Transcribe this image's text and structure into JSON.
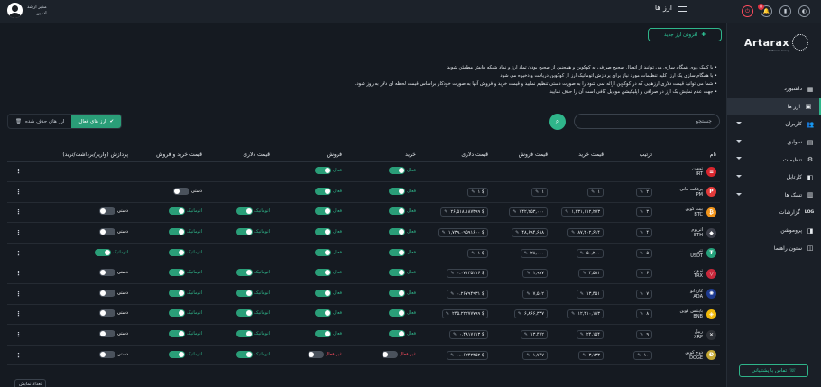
{
  "header": {
    "title": "ارز ها",
    "user_line1": "مدیر ارشد",
    "user_line2": "ادمین",
    "notification_count": "0"
  },
  "sidebar": {
    "logo_name": "Artarax",
    "logo_sub": "Software Group",
    "items": [
      {
        "label": "داشبورد",
        "icon": "▦",
        "chevron": false,
        "active": false
      },
      {
        "label": "ارز ها",
        "icon": "▣",
        "chevron": false,
        "active": true
      },
      {
        "label": "کاربران",
        "icon": "👥",
        "chevron": true,
        "active": false
      },
      {
        "label": "سوابق",
        "icon": "▤",
        "chevron": true,
        "active": false
      },
      {
        "label": "تنظیمات",
        "icon": "⚙",
        "chevron": true,
        "active": false
      },
      {
        "label": "کارتابل",
        "icon": "◧",
        "chevron": true,
        "active": false
      },
      {
        "label": "تسک ها",
        "icon": "▥",
        "chevron": true,
        "active": false
      },
      {
        "label": "گزارشات",
        "icon": "LOG",
        "chevron": false,
        "active": false
      },
      {
        "label": "پروموشن",
        "icon": "◨",
        "chevron": false,
        "active": false
      },
      {
        "label": "ستون راهنما",
        "icon": "◫",
        "chevron": false,
        "active": false
      }
    ],
    "support_label": "تماس با پشتیبانی"
  },
  "toolbar": {
    "add_label": "افزودن ارز جدید",
    "search_placeholder": "جستجو",
    "tab_active_label": "ارز های فعال",
    "tab_deleted_label": "ارز های حذف شده"
  },
  "notes": [
    "• با کلیک روی همگام سازی می توانید از اتصال صحیح صرافی به کوکوین و همچنین از صحیح بودن تماد ارز و نماد شبکه هایش مطمئن شوید",
    "• با همگام سازی یک ارز، کلیه تنظیمات مورد نیاز برای پردازش اتوماتیک ارز از کوکوین دریافت و ذخیره می شود",
    "• شما می توانید قیمت دلاری ارزهایی که در کوکوین ارائه نمی شود را به صورت دستی تنظیم نمایید و قیمت خرید و فروش آنها به صورت خودکار براساس قیمت لحظه ای دلار به روز شود.",
    "• جهت عدم نمایش یک ارز در صرافی و اپلیکیشن موبایل کافی است آن را حذف نمایید"
  ],
  "table": {
    "headers": {
      "name": "نام",
      "order": "ترتیب",
      "buy_price": "قیمت خرید",
      "sell_price": "قیمت فروش",
      "usd_price": "قیمت دلاری",
      "buy": "خرید",
      "sell": "فروش",
      "usd_mode": "قیمت دلاری",
      "buysell_mode": "قیمت خرید و فروش",
      "process": "پردازش (واریز/برداشت/ترید)"
    },
    "rows": [
      {
        "name": "تومان",
        "symbol": "IRT",
        "coin_color": "#d9262e",
        "coin_glyph": "≡",
        "order": "",
        "buy_price": "",
        "sell_price": "",
        "usd_price": "",
        "buy": {
          "on": true,
          "label": "فعال"
        },
        "sell": {
          "on": true,
          "label": "فعال"
        },
        "usd_mode": null,
        "buysell_mode": null,
        "process": null
      },
      {
        "name": "پرفکت مانی",
        "symbol": "PM",
        "coin_color": "#e23a3a",
        "coin_glyph": "P",
        "order": "۲",
        "buy_price": "۱",
        "sell_price": "۱",
        "usd_price": "$ ۱",
        "buy": {
          "on": true,
          "label": "فعال"
        },
        "sell": {
          "on": true,
          "label": "فعال"
        },
        "usd_mode": null,
        "buysell_mode": {
          "on": false,
          "label": "دستی"
        },
        "process": null
      },
      {
        "name": "بیت کوین",
        "symbol": "BTC",
        "coin_color": "#f2951b",
        "coin_glyph": "₿",
        "order": "۳",
        "buy_price": "۱,۳۳۱,۱۱۲,۲۷۳",
        "sell_price": "۷۴۲,۲۵۳,۰۰۰",
        "usd_price": "$ ۲۶,۵۱۸.۱۸۷۳۹۹",
        "buy": {
          "on": true,
          "label": "فعال"
        },
        "sell": {
          "on": true,
          "label": "فعال"
        },
        "usd_mode": {
          "on": true,
          "label": "اتوماتیک"
        },
        "buysell_mode": {
          "on": true,
          "label": "اتوماتیک"
        },
        "process": {
          "on": false,
          "label": "دستی"
        }
      },
      {
        "name": "اتریوم",
        "symbol": "ETH",
        "coin_color": "#3c3f4a",
        "coin_glyph": "◆",
        "order": "۴",
        "buy_price": "۸۷,۳۰۲,۶۱۴",
        "sell_price": "۴۸,۶۹۴,۶۸۸",
        "usd_price": "$ ۱,۷۳۹.۰۹۵۹۱۶۰۰",
        "buy": {
          "on": true,
          "label": "فعال"
        },
        "sell": {
          "on": true,
          "label": "فعال"
        },
        "usd_mode": {
          "on": true,
          "label": "اتوماتیک"
        },
        "buysell_mode": {
          "on": true,
          "label": "اتوماتیک"
        },
        "process": {
          "on": false,
          "label": "دستی"
        }
      },
      {
        "name": "تتر",
        "symbol": "USDT",
        "coin_color": "#26a17b",
        "coin_glyph": "₮",
        "order": "۵",
        "buy_price": "۵۰,۲۰۰",
        "sell_price": "۲۸,۰۰۰",
        "usd_price": "$ ۱",
        "buy": {
          "on": true,
          "label": "فعال"
        },
        "sell": {
          "on": true,
          "label": "فعال"
        },
        "usd_mode": null,
        "buysell_mode": {
          "on": true,
          "label": "اتوماتیک"
        },
        "process": {
          "on": true,
          "label": "اتوماتیک"
        }
      },
      {
        "name": "ترون",
        "symbol": "TRX",
        "coin_color": "#c7283b",
        "coin_glyph": "▽",
        "order": "۶",
        "buy_price": "۳,۵۸۱",
        "sell_price": "۱,۹۹۷",
        "usd_price": "$ ۰.۰۷۱۳۵۲۱۶",
        "buy": {
          "on": true,
          "label": "فعال"
        },
        "sell": {
          "on": true,
          "label": "فعال"
        },
        "usd_mode": {
          "on": true,
          "label": "اتوماتیک"
        },
        "buysell_mode": {
          "on": true,
          "label": "اتوماتیک"
        },
        "process": {
          "on": false,
          "label": "دستی"
        }
      },
      {
        "name": "کاردانو",
        "symbol": "ADA",
        "coin_color": "#1d3a8f",
        "coin_glyph": "✺",
        "order": "۷",
        "buy_price": "۱۳,۴۵۱",
        "sell_price": "۷,۵۰۲",
        "usd_price": "$ ۰.۲۶۷۹۴۹۳۱",
        "buy": {
          "on": true,
          "label": "فعال"
        },
        "sell": {
          "on": true,
          "label": "فعال"
        },
        "usd_mode": {
          "on": true,
          "label": "اتوماتیک"
        },
        "buysell_mode": {
          "on": true,
          "label": "اتوماتیک"
        },
        "process": {
          "on": false,
          "label": "دستی"
        }
      },
      {
        "name": "بایننس کوین",
        "symbol": "BNB",
        "coin_color": "#f0b90b",
        "coin_glyph": "◈",
        "order": "۸",
        "buy_price": "۱۲,۳۱۰,۱۸۳",
        "sell_price": "۶,۸۶۶,۳۳۷",
        "usd_price": "$ ۲۴۵.۲۲۲۷۷۷۹۹",
        "buy": {
          "on": true,
          "label": "فعال"
        },
        "sell": {
          "on": true,
          "label": "فعال"
        },
        "usd_mode": {
          "on": true,
          "label": "اتوماتیک"
        },
        "buysell_mode": {
          "on": true,
          "label": "اتوماتیک"
        },
        "process": {
          "on": false,
          "label": "دستی"
        }
      },
      {
        "name": "ریپل",
        "symbol": "XRP",
        "coin_color": "#2d3138",
        "coin_glyph": "✕",
        "order": "۹",
        "buy_price": "۲۴,۱۵۴",
        "sell_price": "۱۳,۴۷۲",
        "usd_price": "$ ۰.۴۸۱۷۱۱۳",
        "buy": {
          "on": true,
          "label": "فعال"
        },
        "sell": {
          "on": true,
          "label": "فعال"
        },
        "usd_mode": {
          "on": true,
          "label": "اتوماتیک"
        },
        "buysell_mode": {
          "on": true,
          "label": "اتوماتیک"
        },
        "process": {
          "on": false,
          "label": "دستی"
        }
      },
      {
        "name": "دوج کوین",
        "symbol": "DOGE",
        "coin_color": "#c2a633",
        "coin_glyph": "Ð",
        "order": "۱۰",
        "buy_price": "۳,۱۳۳",
        "sell_price": "۱,۷۴۷",
        "usd_price": "$ ۰.۰۶۲۴۲۳۵۲",
        "buy": {
          "on": false,
          "label": "غیر فعال"
        },
        "sell": {
          "on": false,
          "label": "غیر فعال"
        },
        "usd_mode": {
          "on": true,
          "label": "اتوماتیک"
        },
        "buysell_mode": {
          "on": true,
          "label": "اتوماتیک"
        },
        "process": {
          "on": false,
          "label": "دستی"
        }
      }
    ]
  },
  "footer": {
    "count_label": "تعداد نمایش"
  },
  "colors": {
    "accent": "#2a9e78",
    "on_text": "#2fb58a",
    "off_text": "#ff4d5e",
    "manual_text": "#ffffff"
  }
}
